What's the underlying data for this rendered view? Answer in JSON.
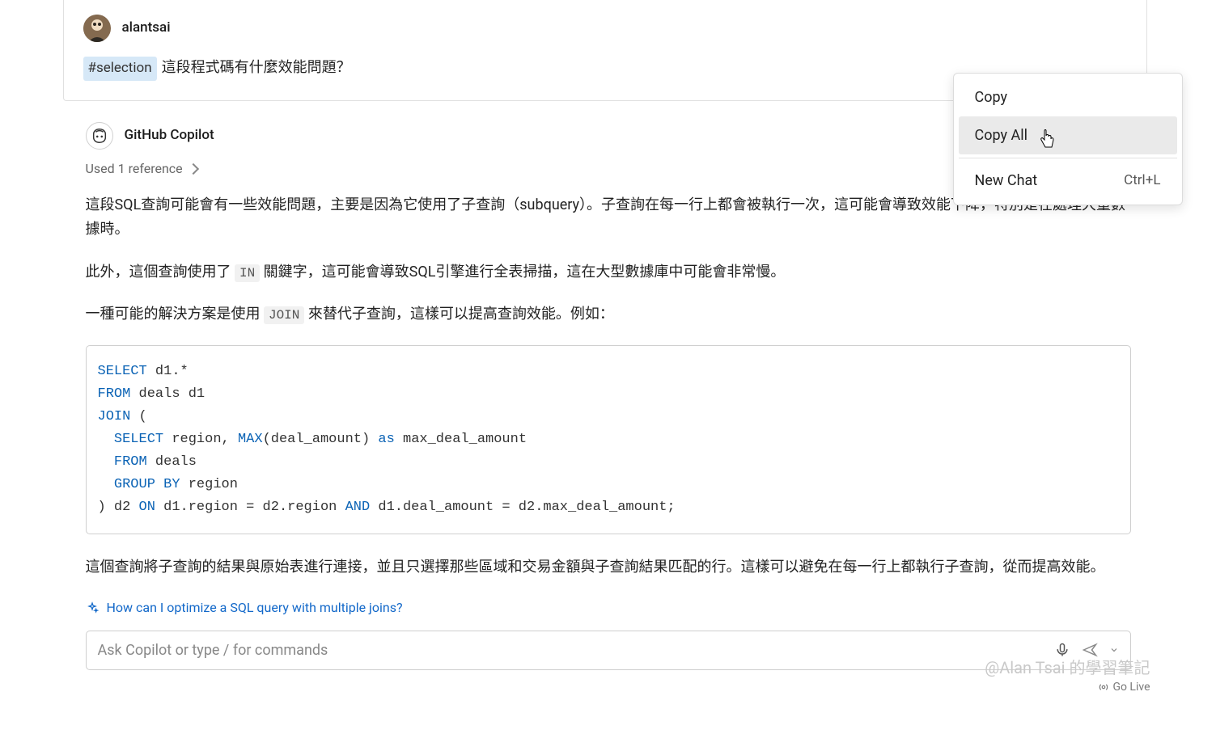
{
  "user": {
    "name": "alantsai",
    "chip": "#selection",
    "prompt_text": "這段程式碼有什麼效能問題？"
  },
  "copilot": {
    "name": "GitHub Copilot",
    "used_ref": "Used 1 reference",
    "para1_pre": "這段SQL查詢可能會有一些效能問題，主要是因為它使用了子查詢（subquery）。子查詢在每一行上都會被執行一次，這可能會導致效能下降，特別是在處理大量數據時。",
    "para2_pre": "此外，這個查詢使用了 ",
    "para2_code": "IN",
    "para2_post": " 關鍵字，這可能會導致SQL引擎進行全表掃描，這在大型數據庫中可能會非常慢。",
    "para3_pre": "一種可能的解決方案是使用 ",
    "para3_code": "JOIN",
    "para3_post": " 來替代子查詢，這樣可以提高查詢效能。例如：",
    "para4": "這個查詢將子查詢的結果與原始表進行連接，並且只選擇那些區域和交易金額與子查詢結果匹配的行。這樣可以避免在每一行上都執行子查詢，從而提高效能。"
  },
  "code": {
    "SELECT": "SELECT",
    "d1_star": " d1.*",
    "FROM": "FROM",
    "deals_d1": " deals d1",
    "JOIN": "JOIN",
    "open_paren": " (",
    "sub_select": "SELECT",
    "sub_cols": " region, ",
    "MAX": "MAX",
    "max_args": "(deal_amount) ",
    "as": "as",
    "alias": " max_deal_amount",
    "sub_from": "FROM",
    "sub_deals": " deals",
    "GROUP": "GROUP",
    "BY": "BY",
    "region": " region",
    "close_paren": ") d2 ",
    "ON": "ON",
    "cond1": " d1.region = d2.region ",
    "AND": "AND",
    "cond2": " d1.deal_amount = d2.max_deal_amount;"
  },
  "follow_up": "How can I optimize a SQL query with multiple joins?",
  "input_placeholder": "Ask Copilot or type / for commands",
  "watermark": "@Alan Tsai 的學習筆記",
  "go_live": "Go Live",
  "menu": {
    "copy": "Copy",
    "copy_all": "Copy All",
    "new_chat": "New Chat",
    "new_chat_shortcut": "Ctrl+L"
  }
}
